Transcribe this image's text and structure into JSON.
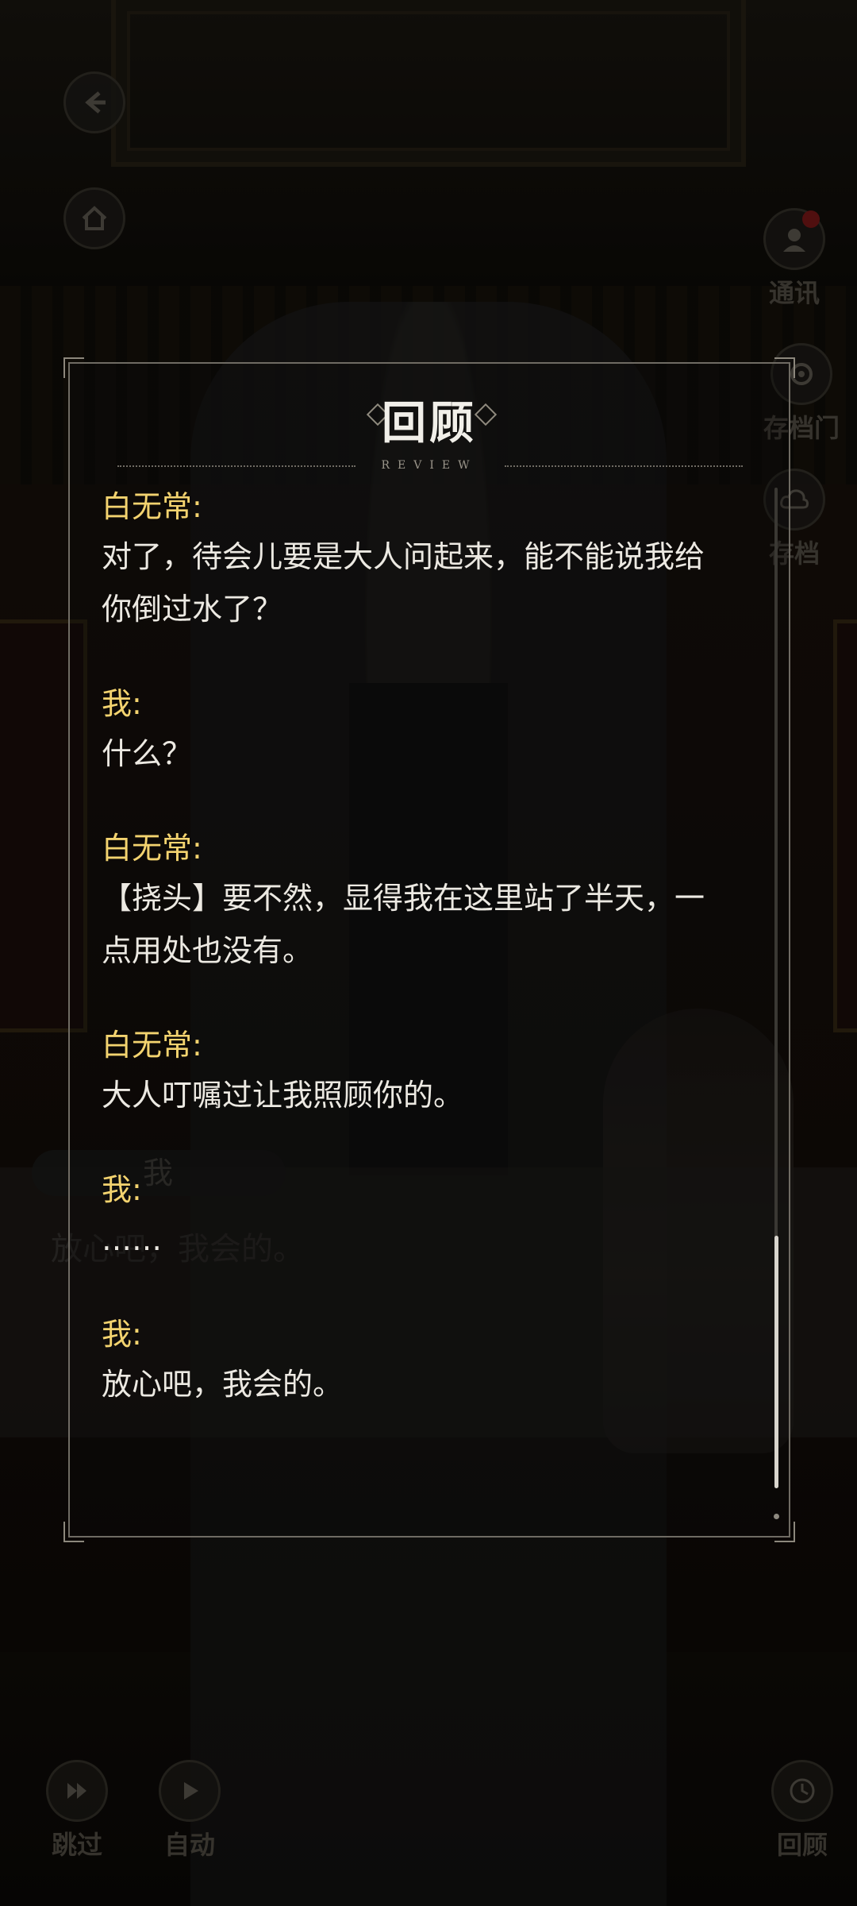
{
  "review": {
    "title": "回顾",
    "subtitle": "REVIEW",
    "entries": [
      {
        "speaker": "白无常:",
        "lines": [
          "对了，待会儿要是大人问起来，能不能说我给",
          "你倒过水了？"
        ]
      },
      {
        "speaker": "我:",
        "lines": [
          "什么？"
        ]
      },
      {
        "speaker": "白无常:",
        "lines": [
          "【挠头】要不然，显得我在这里站了半天，一",
          "点用处也没有。"
        ]
      },
      {
        "speaker": "白无常:",
        "lines": [
          "大人叮嘱过让我照顾你的。"
        ]
      },
      {
        "speaker": "我:",
        "lines": [
          "……"
        ]
      },
      {
        "speaker": "我:",
        "lines": [
          "放心吧，我会的。"
        ]
      }
    ]
  },
  "background": {
    "dialog_name": "我",
    "dialog_text": "放心吧，我会的。"
  },
  "controls": {
    "back_icon": "back-arrow-icon",
    "home_icon": "home-icon",
    "right_labels": [
      "通讯",
      "存档门",
      "存档"
    ],
    "skip_label": "跳过",
    "auto_label": "自动",
    "review_label": "回顾"
  },
  "colors": {
    "speaker": "#f3d36f",
    "text": "#ece9e2",
    "frame": "#6f6b63"
  }
}
